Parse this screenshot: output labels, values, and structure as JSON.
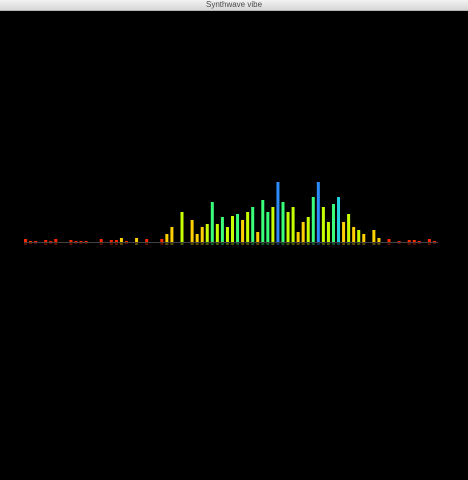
{
  "window": {
    "title": "Synthwave vibe"
  },
  "visualizer": {
    "type": "bar",
    "bar_count": 82,
    "heights": [
      3,
      1,
      1,
      0,
      2,
      1,
      3,
      0,
      0,
      2,
      1,
      1,
      1,
      0,
      0,
      3,
      0,
      2,
      2,
      4,
      1,
      0,
      4,
      0,
      3,
      0,
      0,
      3,
      8,
      15,
      0,
      30,
      0,
      22,
      8,
      15,
      18,
      40,
      18,
      25,
      15,
      26,
      28,
      22,
      30,
      35,
      10,
      42,
      30,
      35,
      60,
      40,
      30,
      35,
      10,
      20,
      25,
      45,
      60,
      35,
      20,
      38,
      45,
      20,
      28,
      15,
      12,
      8,
      0,
      12,
      4,
      0,
      3,
      0,
      1,
      0,
      2,
      2,
      1,
      0,
      3,
      1
    ],
    "colors": {
      "low": "#ff2a00",
      "mid_low": "#ffd000",
      "mid": "#c8ff00",
      "mid_high": "#39ff7a",
      "high": "#22d0e0",
      "peak": "#2a8cff"
    },
    "baseline_color": "#ffffff"
  }
}
